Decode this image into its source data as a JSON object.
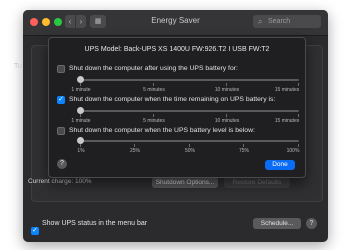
{
  "window": {
    "title": "Energy Saver",
    "search_placeholder": "Search",
    "back_label": "‹",
    "forward_label": "›",
    "grid_label": "▦"
  },
  "background": {
    "left_label": "Tu",
    "current_charge": "Current charge: 100%",
    "shutdown_options_label": "Shutdown Options...",
    "restore_defaults_label": "Restore Defaults",
    "show_ups_status_label": "Show UPS status in the menu bar",
    "schedule_label": "Schedule...",
    "help_label": "?"
  },
  "sheet": {
    "ups_model": "UPS Model:  Back-UPS XS 1400U  FW:926.T2  I USB FW:T2",
    "options": [
      {
        "label": "Shut down the computer after using the UPS battery for:",
        "checked": false,
        "ticks": [
          "1 minute",
          "5 minutes",
          "10 minutes",
          "15 minutes"
        ]
      },
      {
        "label": "Shut down the computer when the time remaining on UPS battery is:",
        "checked": true,
        "ticks": [
          "1 minute",
          "5 minutes",
          "10 minutes",
          "15 minutes"
        ]
      },
      {
        "label": "Shut down the computer when the UPS battery level is below:",
        "checked": false,
        "ticks": [
          "1%",
          "25%",
          "50%",
          "75%",
          "100%"
        ]
      }
    ],
    "help_label": "?",
    "done_label": "Done"
  },
  "colors": {
    "accent": "#0a84ff",
    "done_button": "#0a6cf5"
  }
}
